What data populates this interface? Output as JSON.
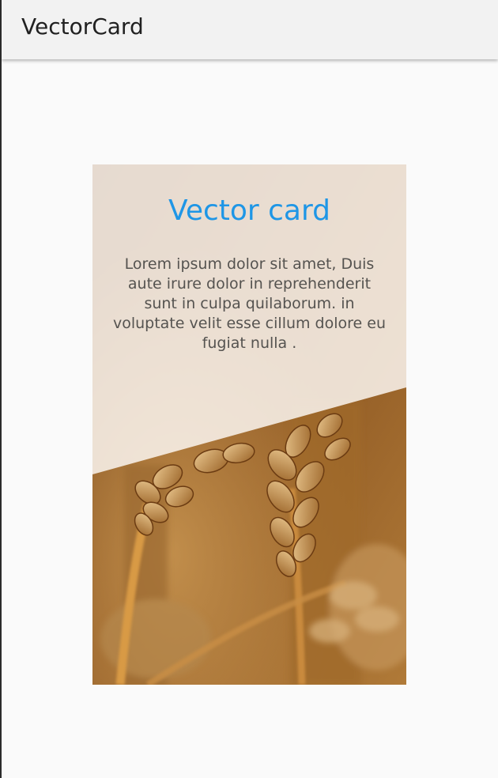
{
  "app_bar": {
    "title": "VectorCard"
  },
  "card": {
    "title": "Vector card",
    "body": "Lorem ipsum dolor sit amet, Duis aute irure dolor in reprehenderit sunt in culpa quilaborum. in voluptate velit esse cillum dolore eu fugiat nulla .",
    "image": "wheat-ears-photo",
    "colors": {
      "title": "#1e96e6",
      "body_text": "#555350",
      "overlay": "#faf5ef"
    }
  },
  "colors": {
    "app_bar_bg": "#f2f2f2",
    "screen_bg": "#fafafa",
    "title_text": "#212121"
  }
}
